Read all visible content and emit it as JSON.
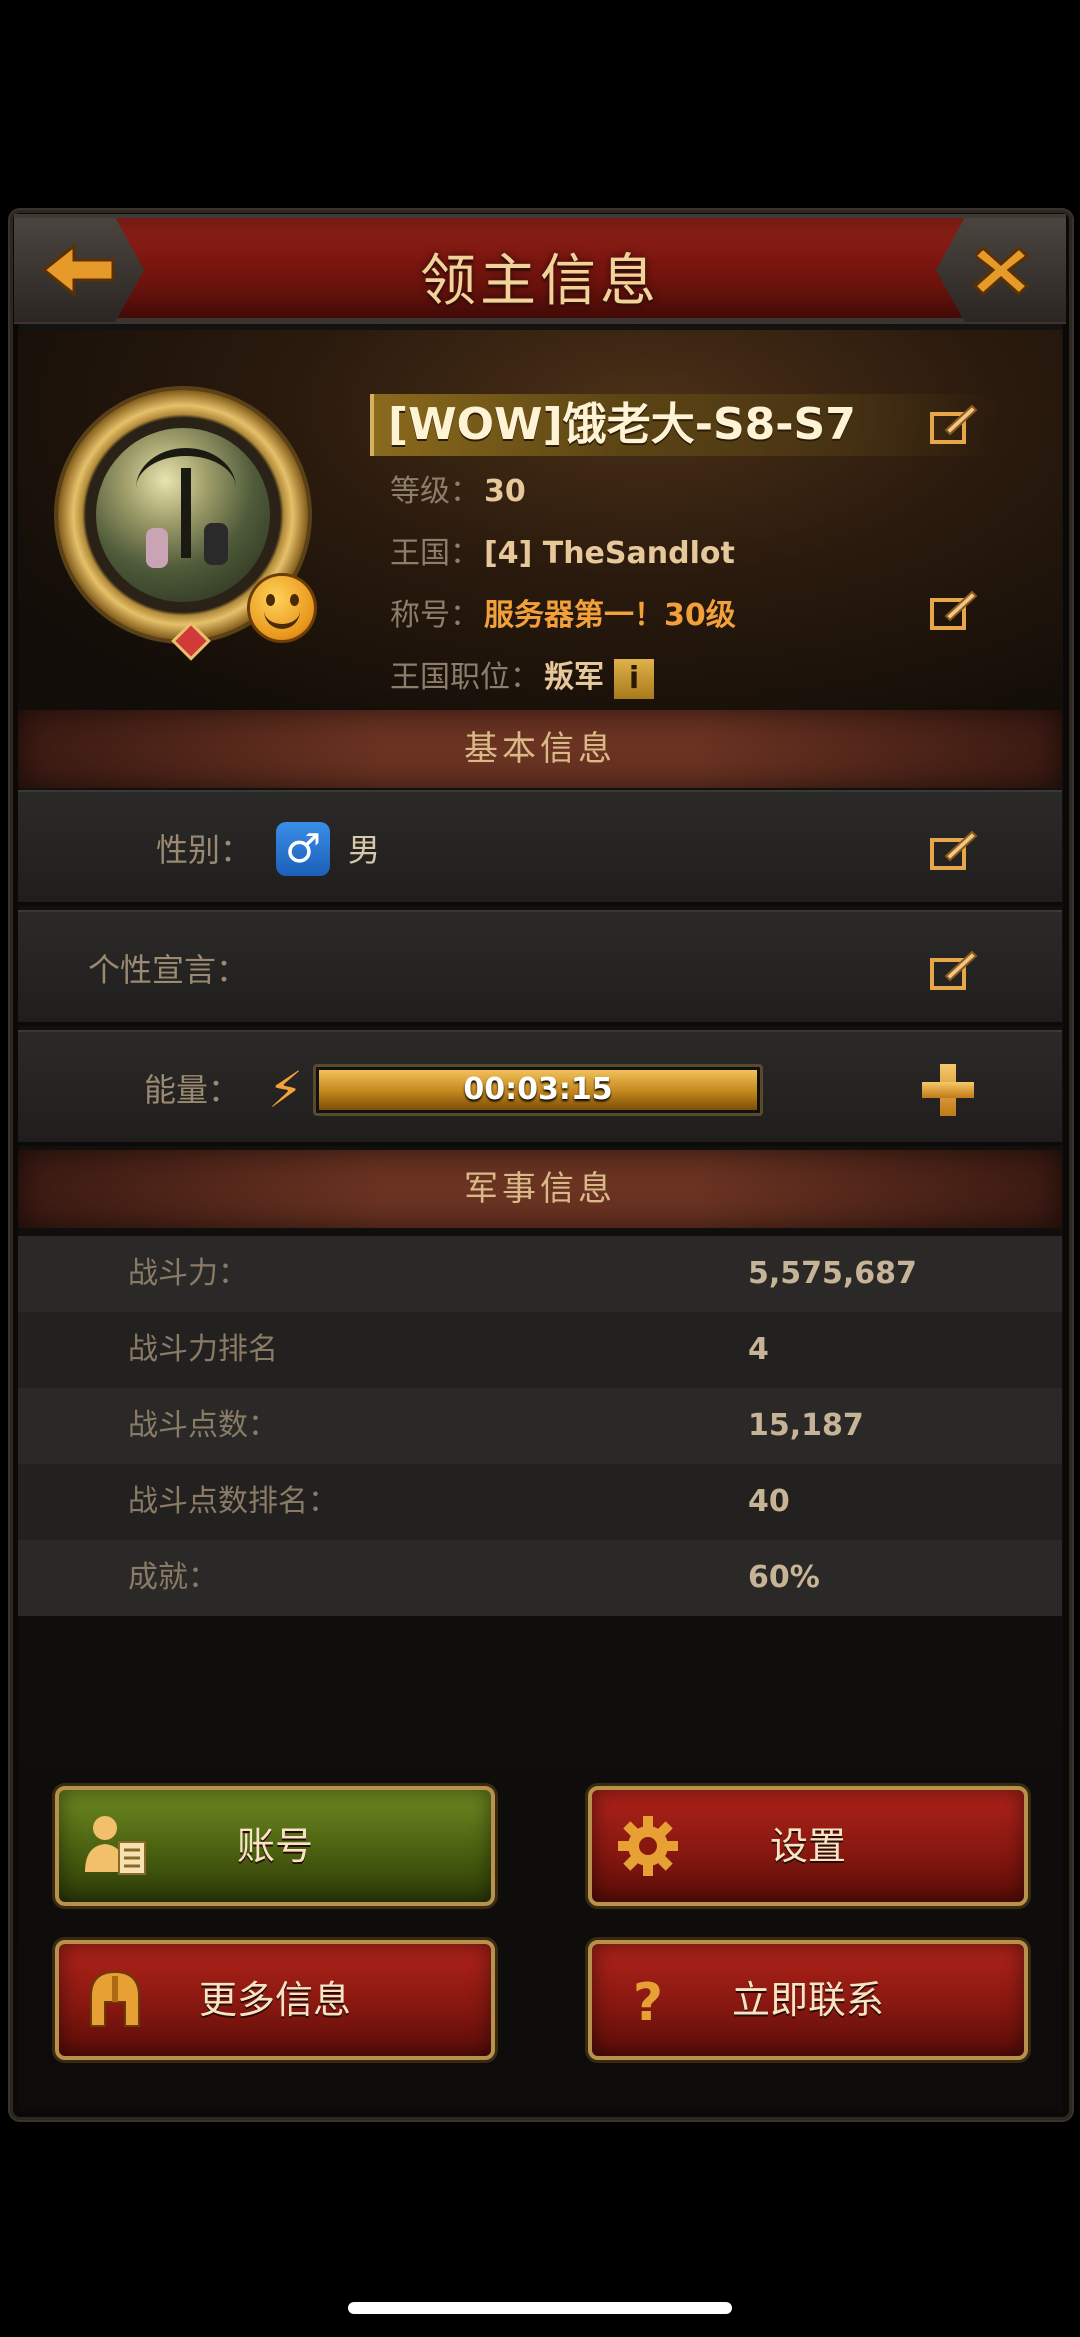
{
  "window": {
    "title": "领主信息"
  },
  "profile": {
    "name": "[WOW]饿老大-S8-S7",
    "level_label": "等级：",
    "level_value": "30",
    "kingdom_label": "王国：",
    "kingdom_value": "[4] TheSandlot",
    "title_label": "称号：",
    "title_value": "服务器第一！30级",
    "position_label": "王国职位：",
    "position_value": "叛军",
    "info_glyph": "i"
  },
  "basic": {
    "header": "基本信息",
    "gender_label": "性别：",
    "gender_value": "男",
    "gender_glyph": "♂",
    "motto_label": "个性宣言：",
    "energy_label": "能量：",
    "energy_timer": "00:03:15",
    "energy_fill": 1.0
  },
  "military": {
    "header": "军事信息",
    "stats": [
      {
        "label": "战斗力：",
        "value": "5,575,687"
      },
      {
        "label": "战斗力排名",
        "value": "4"
      },
      {
        "label": "战斗点数：",
        "value": "15,187"
      },
      {
        "label": "战斗点数排名：",
        "value": "40"
      },
      {
        "label": "成就：",
        "value": "60%"
      }
    ]
  },
  "buttons": {
    "account": "账号",
    "settings": "设置",
    "more_info": "更多信息",
    "contact": "立即联系"
  },
  "icons": {
    "back": "back-arrow-icon",
    "close": "close-icon",
    "edit": "edit-icon",
    "energy": "lightning-icon",
    "add": "plus-icon",
    "account": "user-icon",
    "settings": "gear-icon",
    "more": "helmet-icon",
    "contact": "question-icon"
  },
  "colors": {
    "accent_gold": "#e6c16a",
    "title_red": "#7a160f",
    "green_button": "#4a6010",
    "red_button": "#871810"
  }
}
